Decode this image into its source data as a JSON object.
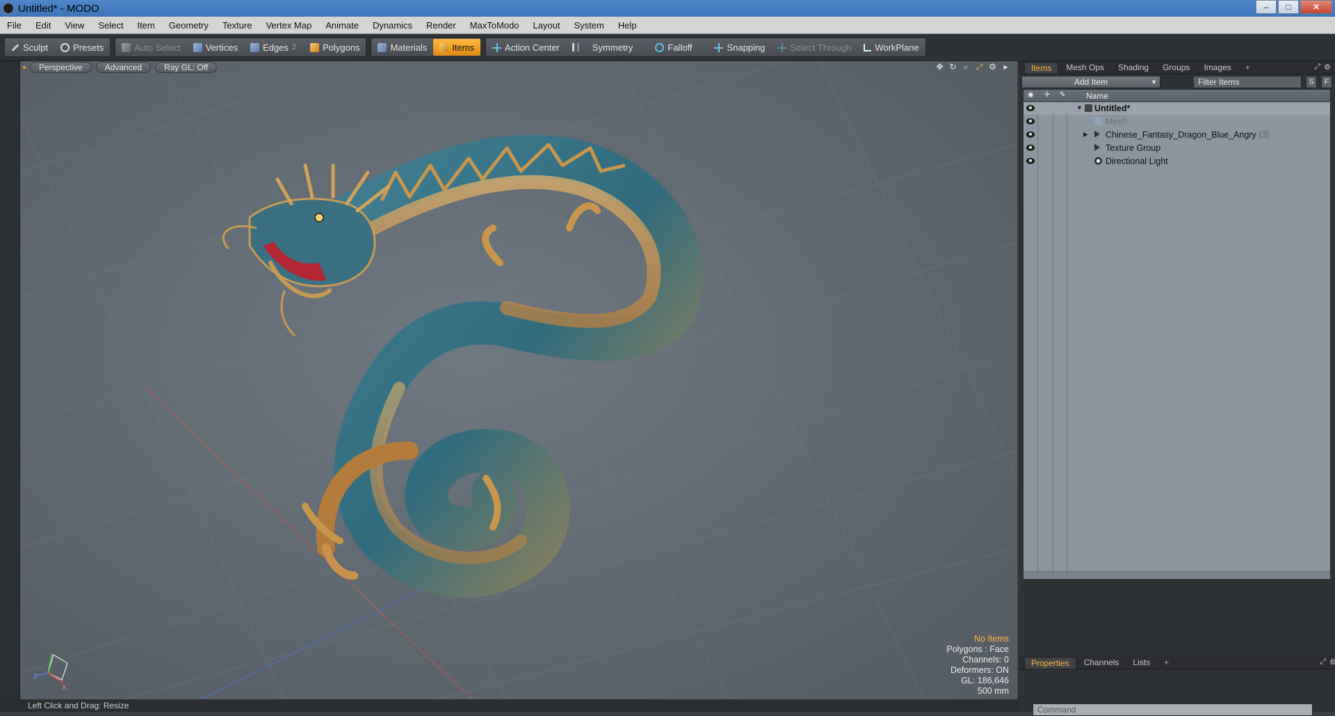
{
  "window": {
    "title": "Untitled* - MODO",
    "min": "–",
    "max": "□",
    "close": "✕"
  },
  "menu": [
    "File",
    "Edit",
    "View",
    "Select",
    "Item",
    "Geometry",
    "Texture",
    "Vertex Map",
    "Animate",
    "Dynamics",
    "Render",
    "MaxToModo",
    "Layout",
    "System",
    "Help"
  ],
  "toolbar": {
    "sculpt": "Sculpt",
    "presets": "Presets",
    "auto_select": "Auto Select",
    "vertices": "Vertices",
    "edges": "Edges",
    "edges_count": "2",
    "polygons": "Polygons",
    "materials": "Materials",
    "items": "Items",
    "action_center": "Action Center",
    "symmetry": "Symmetry",
    "falloff": "Falloff",
    "snapping": "Snapping",
    "select_through": "Select Through",
    "workplane": "WorkPlane"
  },
  "viewport": {
    "view": "Perspective",
    "shading": "Advanced",
    "raygl": "Ray GL: Off",
    "stats": {
      "no_items": "No Items",
      "polygons": "Polygons : Face",
      "channels": "Channels: 0",
      "deformers": "Deformers: ON",
      "gl": "GL: 186,646",
      "scale": "500 mm"
    },
    "axis_z": "Z",
    "axis_x": "X"
  },
  "status": "Left Click and Drag:  Resize",
  "items_panel": {
    "tabs": [
      "Items",
      "Mesh Ops",
      "Shading",
      "Groups",
      "Images"
    ],
    "plus": "+",
    "add_item": "Add Item",
    "filter_placeholder": "Filter Items",
    "btn_s": "S",
    "btn_f": "F",
    "col_name": "Name",
    "rows": [
      {
        "label": "Untitled*"
      },
      {
        "label": "Mesh"
      },
      {
        "label": "Chinese_Fantasy_Dragon_Blue_Angry",
        "extra": "(3)"
      },
      {
        "label": "Texture Group"
      },
      {
        "label": "Directional Light"
      }
    ]
  },
  "properties_panel": {
    "tabs": [
      "Properties",
      "Channels",
      "Lists"
    ],
    "plus": "+",
    "command_placeholder": "Command"
  },
  "colors": {
    "accent": "#ffb340",
    "viewport": "#5f676f",
    "panel": "#2f3235"
  }
}
